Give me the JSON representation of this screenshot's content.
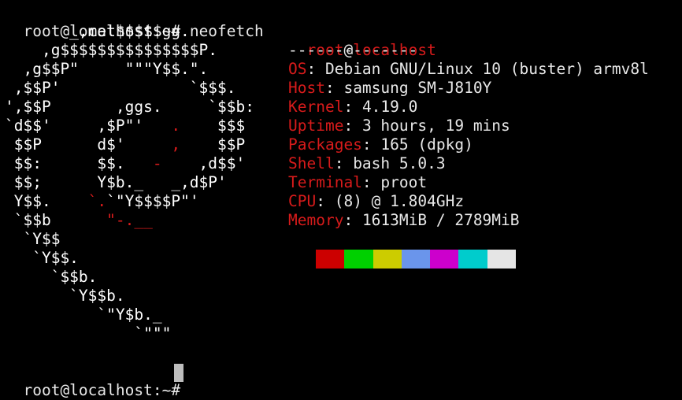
{
  "terminal": {
    "command_line": {
      "prompt": "root@localhost:~#",
      "command": "neofetch"
    },
    "logo_lines": [
      [
        {
          "t": "       _,met$$$$$gg.",
          "c": "w"
        }
      ],
      [
        {
          "t": "    ,g$$$$$$$$$$$$$$$P.",
          "c": "w"
        }
      ],
      [
        {
          "t": "  ,g$$P\"     \"\"\"Y$$.\".",
          "c": "w"
        }
      ],
      [
        {
          "t": " ,$$P'              `$$$.",
          "c": "w"
        }
      ],
      [
        {
          "t": "',$$P       ,ggs.     `$$b:",
          "c": "w"
        }
      ],
      [
        {
          "t": "`d$$'     ,$P\"'   ",
          "c": "w"
        },
        {
          "t": ".",
          "c": "r"
        },
        {
          "t": "    $$$",
          "c": "w"
        }
      ],
      [
        {
          "t": " $$P      d$'     ",
          "c": "w"
        },
        {
          "t": ",",
          "c": "r"
        },
        {
          "t": "    $$P",
          "c": "w"
        }
      ],
      [
        {
          "t": " $$:      $$.   ",
          "c": "w"
        },
        {
          "t": "-",
          "c": "r"
        },
        {
          "t": "    ,d$$'",
          "c": "w"
        }
      ],
      [
        {
          "t": " $$;      Y$b._   _,d$P'",
          "c": "w"
        }
      ],
      [
        {
          "t": " Y$$.    ",
          "c": "w"
        },
        {
          "t": "`.",
          "c": "r"
        },
        {
          "t": "`\"Y$$$$P\"'",
          "c": "w"
        }
      ],
      [
        {
          "t": " `$$b      ",
          "c": "w"
        },
        {
          "t": "\"-.__",
          "c": "r"
        }
      ],
      [
        {
          "t": "  `Y$$",
          "c": "w"
        }
      ],
      [
        {
          "t": "   `Y$$.",
          "c": "w"
        }
      ],
      [
        {
          "t": "     `$$b.",
          "c": "w"
        }
      ],
      [
        {
          "t": "       `Y$$b.",
          "c": "w"
        }
      ],
      [
        {
          "t": "          `\"Y$b._",
          "c": "w"
        }
      ],
      [
        {
          "t": "              `\"\"\"",
          "c": "w"
        }
      ]
    ],
    "info": {
      "user": "root",
      "at": "@",
      "host": "localhost",
      "separator": "--------------",
      "rows": [
        {
          "key": "OS",
          "value": "Debian GNU/Linux 10 (buster) armv8l"
        },
        {
          "key": "Host",
          "value": "samsung SM-J810Y"
        },
        {
          "key": "Kernel",
          "value": "4.19.0"
        },
        {
          "key": "Uptime",
          "value": "3 hours, 19 mins"
        },
        {
          "key": "Packages",
          "value": "165 (dpkg)"
        },
        {
          "key": "Shell",
          "value": "bash 5.0.3"
        },
        {
          "key": "Terminal",
          "value": "proot"
        },
        {
          "key": "CPU",
          "value": "(8) @ 1.804GHz"
        },
        {
          "key": "Memory",
          "value": "1613MiB / 2789MiB"
        }
      ],
      "key_suffix": ": "
    },
    "color_swatches": [
      "#cc0000",
      "#00d000",
      "#cccc00",
      "#6a95eb",
      "#cc00cc",
      "#00cccc",
      "#e5e5e5"
    ],
    "prompt_line": {
      "prompt": "root@localhost:~#"
    },
    "colors": {
      "accent_red": "#d81b1b",
      "text": "#e8e8e8",
      "background": "#000000"
    }
  }
}
